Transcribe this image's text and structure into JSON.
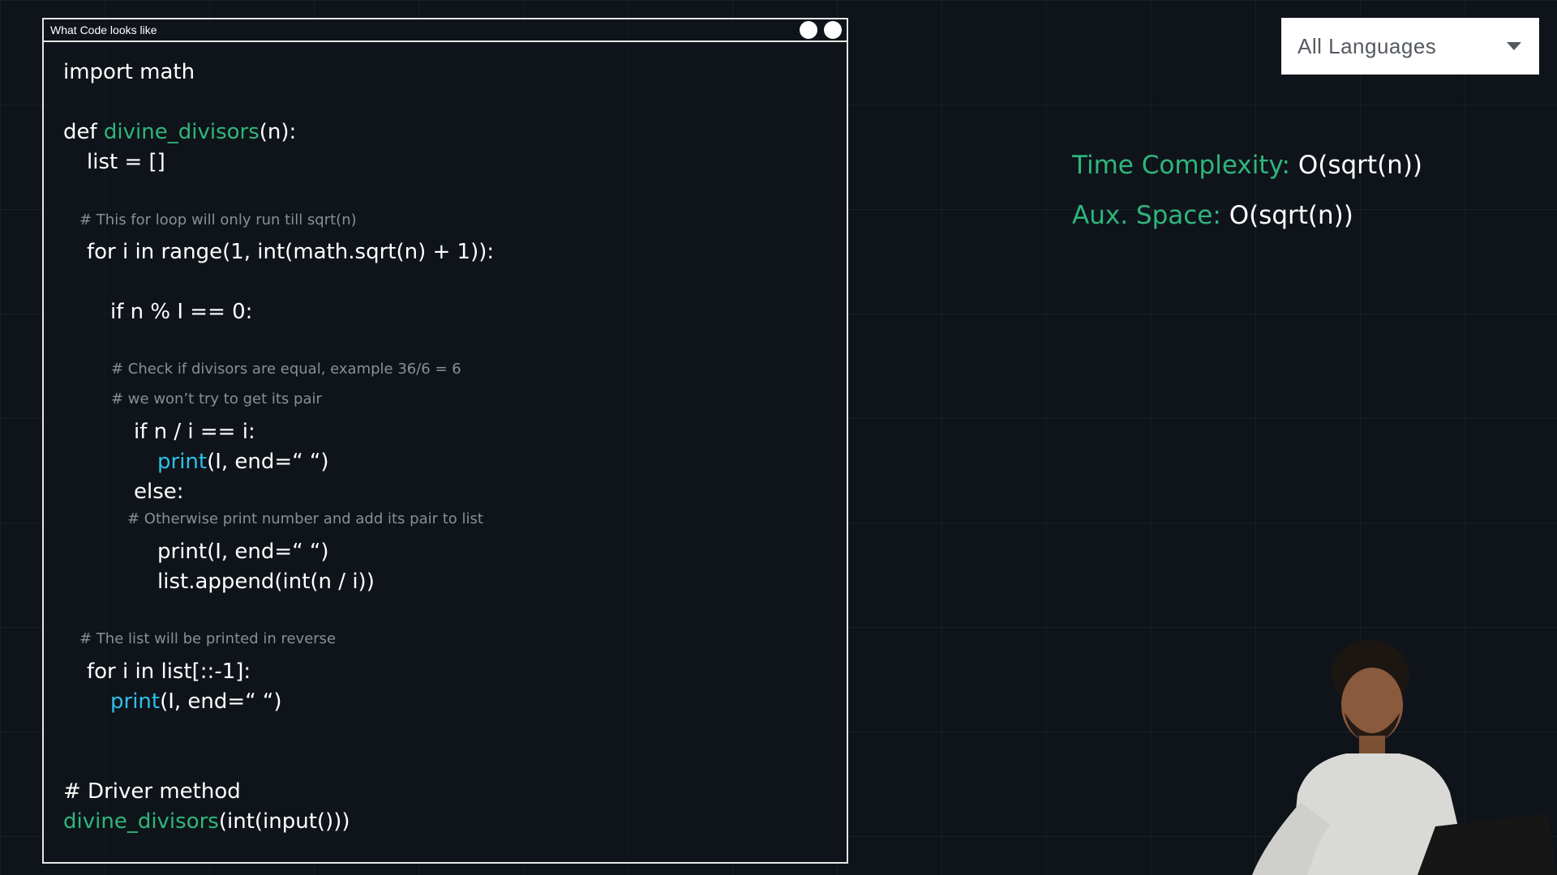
{
  "window": {
    "title": "What Code looks like"
  },
  "code": {
    "l1": "import math",
    "l2_kw": "def ",
    "l2_fn": "divine_divisors",
    "l2_rest": "(n):",
    "l3": "list = []",
    "c1": "# This for loop will only run till sqrt(n)",
    "l4": "for i in range(1, int(math.sqrt(n) + 1)):",
    "l5": "if n % I == 0:",
    "c2": "# Check if divisors are equal, example 36/6 = 6",
    "c3": "# we won’t try to get its pair",
    "l6": "if n / i == i:",
    "l7_fn": "print",
    "l7_rest": "(I, end=“ “)",
    "l8": "else:",
    "c4": "# Otherwise print number and add its pair to list",
    "l9": "print(I, end=“ “)",
    "l10": "list.append(int(n / i))",
    "c5": "# The list will be printed in reverse",
    "l11": "for i in list[::-1]:",
    "l12_fn": "print",
    "l12_rest": "(I, end=“ “)",
    "l13": "# Driver method",
    "l14_fn": "divine_divisors",
    "l14_rest": "(int(input()))"
  },
  "language_select": {
    "selected": "All Languages"
  },
  "complexity": {
    "time_label": "Time Complexity:",
    "time_value": "O(sqrt(n))",
    "space_label": "Aux. Space:",
    "space_value": "O(sqrt(n))"
  },
  "colors": {
    "accent_green": "#2fb67c",
    "accent_blue": "#2fc0e6",
    "background": "#0f141b"
  }
}
